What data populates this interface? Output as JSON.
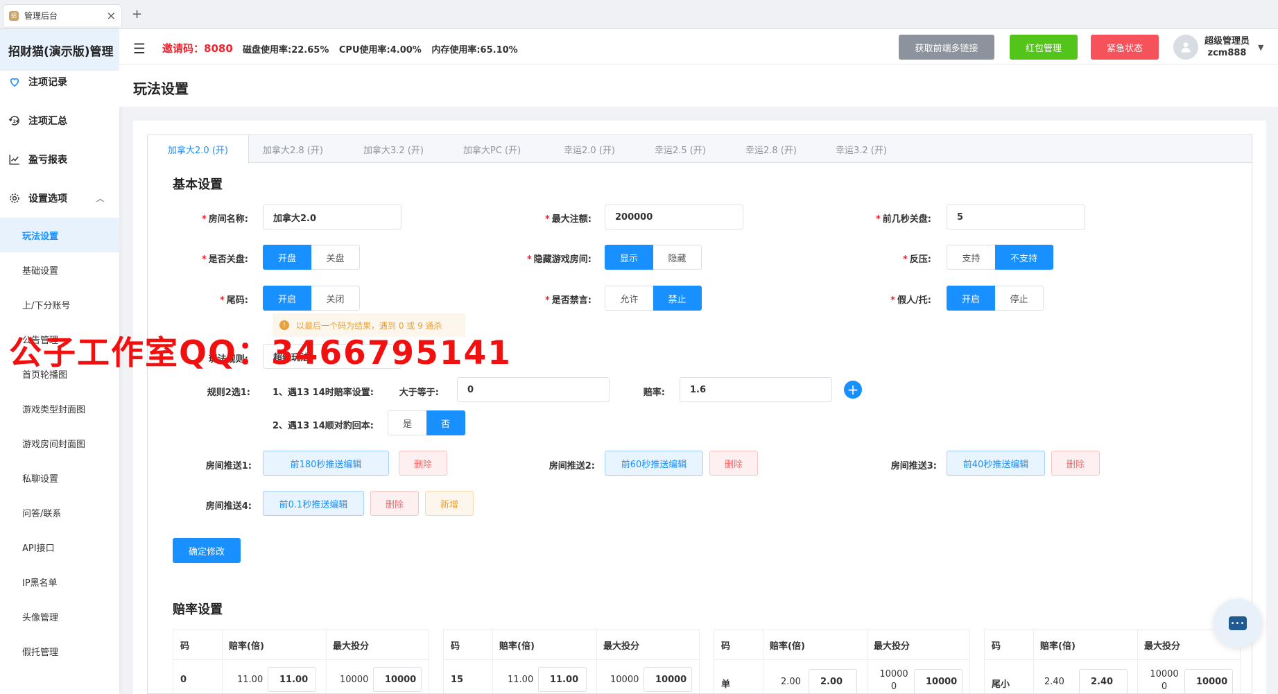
{
  "browser": {
    "tab_title": "管理后台",
    "close": "×",
    "new_tab": "+",
    "favicon": "招"
  },
  "sidebar": {
    "app_title": "招财猫(演示版)管理",
    "items": [
      {
        "label": "注项记录",
        "icon": "heart-icon"
      },
      {
        "label": "注项汇总",
        "icon": "clock-24-icon"
      },
      {
        "label": "盈亏报表",
        "icon": "chart-line-icon"
      },
      {
        "label": "设置选项",
        "icon": "gear-icon",
        "arrow": "︿"
      }
    ],
    "sub_items": [
      "玩法设置",
      "基础设置",
      "上/下分账号",
      "公告管理",
      "首页轮播图",
      "游戏类型封面图",
      "游戏房间封面图",
      "私聊设置",
      "问答/联系",
      "API接口",
      "IP黑名单",
      "头像管理",
      "假托管理"
    ]
  },
  "header": {
    "menu_icon": "☰",
    "invite_label": "邀请码：",
    "invite_code": "8080",
    "disk": "磁盘使用率:22.65%",
    "cpu": "CPU使用率:4.00%",
    "mem": "内存使用率:65.10%",
    "btn_links": "获取前端多链接",
    "btn_redpack": "红包管理",
    "btn_emergency": "紧急状态",
    "user_role": "超级管理员",
    "user_name": "zcm888",
    "dropdown": "▼",
    "colors": {
      "gray": "#8c939d",
      "green": "#52c41a",
      "red": "#f5525c"
    }
  },
  "page": {
    "title": "玩法设置"
  },
  "tabs": [
    "加拿大2.0 (开)",
    "加拿大2.8 (开)",
    "加拿大3.2 (开)",
    "加拿大PC (开)",
    "幸运2.0 (开)",
    "幸运2.5 (开)",
    "幸运2.8 (开)",
    "幸运3.2 (开)"
  ],
  "basic": {
    "title": "基本设置",
    "room_name_label": "房间名称:",
    "room_name": "加拿大2.0",
    "max_bet_label": "最大注额:",
    "max_bet": "200000",
    "close_secs_label": "前几秒关盘:",
    "close_secs": "5",
    "is_close_label": "是否关盘:",
    "is_close_opts": [
      "开盘",
      "关盘"
    ],
    "hide_room_label": "隐藏游戏房间:",
    "hide_room_opts": [
      "显示",
      "隐藏"
    ],
    "reverse_label": "反压:",
    "reverse_opts": [
      "支持",
      "不支持"
    ],
    "tail_label": "尾码:",
    "tail_opts": [
      "开启",
      "关闭"
    ],
    "mute_label": "是否禁言:",
    "mute_opts": [
      "允许",
      "禁止"
    ],
    "fake_label": "假人/托:",
    "fake_opts": [
      "开启",
      "停止"
    ],
    "tail_tip": "以最后一个码为结果，遇到 0 或 9 通杀",
    "warn_icon": "!",
    "rule_label": "玩法规则:",
    "rule_value": "超级玩法",
    "rule2_label": "规则2选1:",
    "rule2_a": "1、遇13 14时赔率设置:",
    "gte_label": "大于等于:",
    "gte_value": "0",
    "odds_label": "赔率:",
    "odds_value": "1.6",
    "plus": "+",
    "rule2_b": "2、遇13 14顺对豹回本:",
    "rule2_b_opts": [
      "是",
      "否"
    ],
    "push1_label": "房间推送1:",
    "push1_btn": "前180秒推送编辑",
    "push2_label": "房间推送2:",
    "push2_btn": "前60秒推送编辑",
    "push3_label": "房间推送3:",
    "push3_btn": "前40秒推送编辑",
    "push4_label": "房间推送4:",
    "push4_btn": "前0.1秒推送编辑",
    "delete": "删除",
    "add": "新增",
    "confirm": "确定修改"
  },
  "odds": {
    "title": "赔率设置",
    "headers": [
      "码",
      "赔率(倍)",
      "最大投分"
    ],
    "tables": [
      {
        "code": "0",
        "rate": "11.00",
        "rate_input": "11.00",
        "max": "10000",
        "max_input": "10000"
      },
      {
        "code": "15",
        "rate": "11.00",
        "rate_input": "11.00",
        "max": "10000",
        "max_input": "10000"
      },
      {
        "code": "单",
        "rate": "2.00",
        "rate_input": "2.00",
        "max": "10000 0",
        "max_input": "10000"
      },
      {
        "code": "尾小",
        "rate": "2.40",
        "rate_input": "2.40",
        "max": "10000 0",
        "max_input": "10000"
      }
    ]
  },
  "watermark": "公子工作室QQ：3466795141",
  "chat_icon": "chat-bubble-icon"
}
